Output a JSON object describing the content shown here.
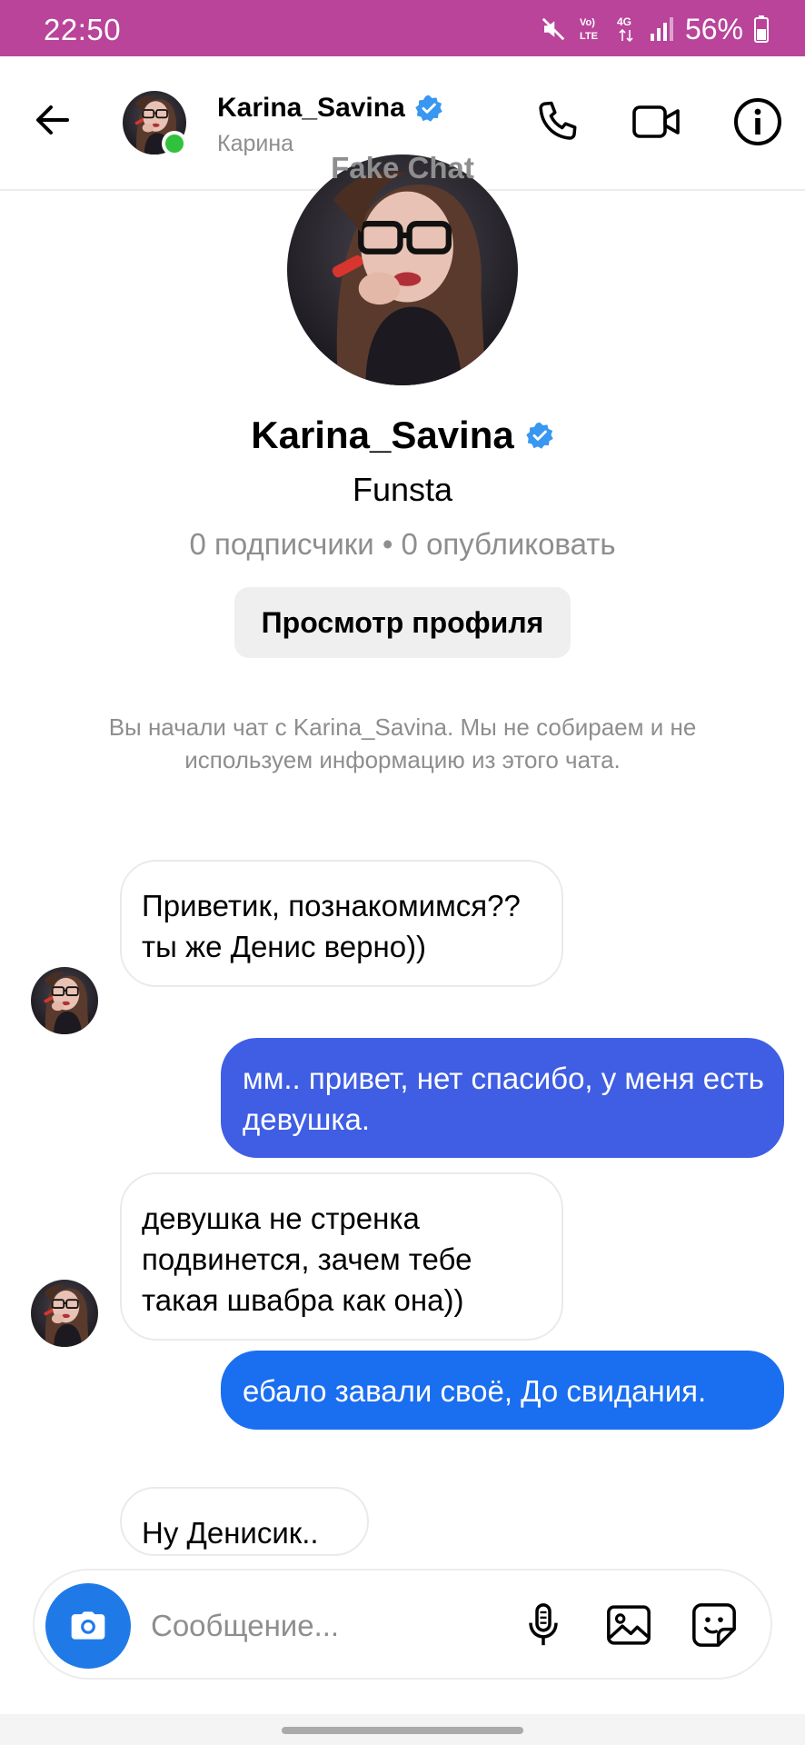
{
  "status_bar": {
    "time": "22:50",
    "battery": "56%",
    "background": "#b9449a",
    "icons": [
      "mute-icon",
      "volte-icon",
      "4g-icon",
      "signal-icon",
      "battery-icon"
    ]
  },
  "header": {
    "name": "Karina_Savina",
    "subtitle": "Карина",
    "online": true,
    "watermark": "Fake Chat",
    "icons": [
      "back-arrow-icon",
      "phone-icon",
      "video-icon",
      "info-icon",
      "verified-badge-icon"
    ]
  },
  "profile": {
    "name": "Karina_Savina",
    "subtitle": "Funsta",
    "stats": "0 подписчики • 0 опубликовать",
    "view_profile_label": "Просмотр профиля",
    "notice": "Вы начали чат с Karina_Savina. Мы не собираем и не используем информацию из этого чата."
  },
  "messages": [
    {
      "from": "them",
      "text": "Приветик, познакомимся?? ты же Денис верно))"
    },
    {
      "from": "me",
      "text": "мм.. привет, нет спасибо, у меня есть девушка."
    },
    {
      "from": "them",
      "text": "девушка не стренка подвинется, зачем тебе такая швабра как она))"
    },
    {
      "from": "me",
      "text": "ебало завали своё, До свидания."
    },
    {
      "from": "them",
      "text": "Ну Денисик.."
    }
  ],
  "composer": {
    "placeholder": "Сообщение...",
    "icons": [
      "camera-icon",
      "microphone-icon",
      "gallery-icon",
      "sticker-icon"
    ]
  },
  "colors": {
    "outgoing_bubble": "#3f5ee4",
    "outgoing_bubble_2": "#1a6ef0",
    "verified_badge": "#3897f0",
    "online": "#31c23d",
    "camera_button": "#1f7ae8"
  }
}
